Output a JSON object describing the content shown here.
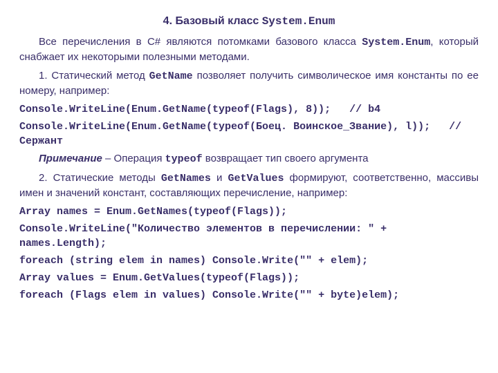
{
  "heading": {
    "num": "4. ",
    "title": "Базовый класс ",
    "code": "System.Enum"
  },
  "p1": {
    "prefix": "Все перечисления в С# являются потомками базового класса ",
    "code": "System.Enum",
    "suffix": ", который снабжает их некоторыми полезными методами."
  },
  "p2": {
    "prefix": "1. Статический метод ",
    "method": "GetName",
    "suffix": " позволяет получить символическое имя константы по ее номеру, например:"
  },
  "code1": "Console.WriteLine(Enum.GetName(typeof(Flags), 8));   // b4",
  "code2": "Console.WriteLine(Enum.GetName(typeof(Боец. Воинское_Звание), l));   // Сержант",
  "note": {
    "label": "Примечание",
    "dash": " – ",
    "prefix": "Операция ",
    "code": "typeof",
    "suffix": " возвращает тип своего аргумента"
  },
  "p3": {
    "prefix": "2. Статические методы ",
    "m1": "GetNames",
    "mid": " и ",
    "m2": "GetValues",
    "suffix": " формируют, соответственно, массивы имен и значений констант, составляющих перечисление, например:"
  },
  "code3": "Array names = Enum.GetNames(typeof(Flags));",
  "code4": "Console.WriteLine(\"Количество элементов в перечислении: \" + names.Length);",
  "code5": "foreach (string elem in names) Console.Write(\"\" + elem);",
  "code6": "Array values = Enum.GetValues(typeof(Flags));",
  "code7": "foreach (Flags elem in values) Console.Write(\"\" + byte)elem);"
}
